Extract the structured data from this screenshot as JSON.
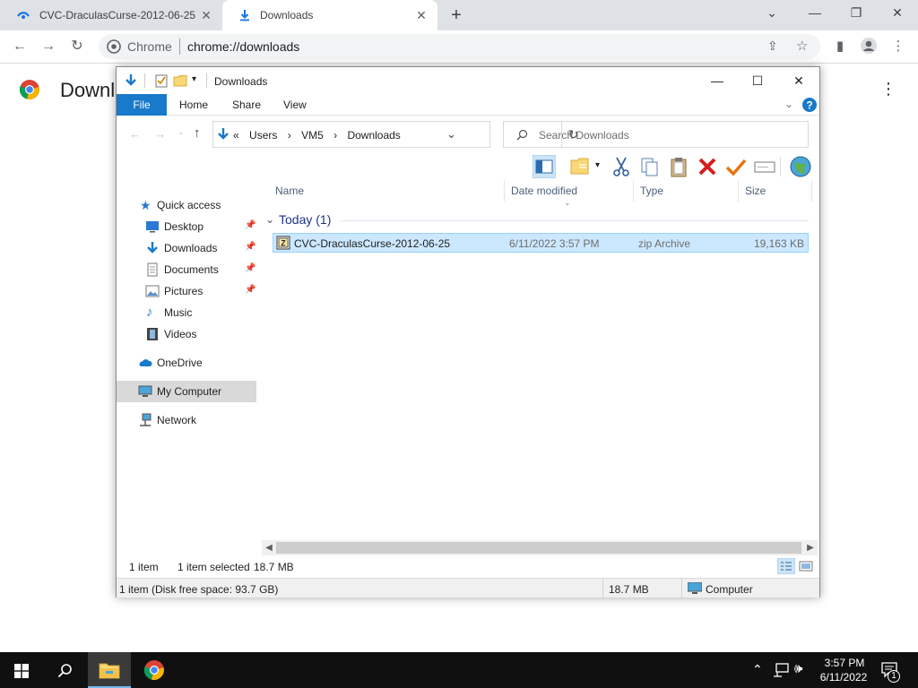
{
  "browser": {
    "tabs": [
      {
        "title": "CVC-DraculasCurse-2012-06-25",
        "icon": "tab-page-icon"
      },
      {
        "title": "Downloads",
        "icon": "download-icon",
        "active": true
      }
    ],
    "window_controls": {
      "minimize": "—",
      "restore": "❐",
      "close": "✕",
      "tab_search": "⌄"
    },
    "omnibox": {
      "site_label": "Chrome",
      "url": "chrome://downloads"
    },
    "page": {
      "heading": "Downloads"
    }
  },
  "explorer": {
    "title": "Downloads",
    "ribbon_tabs": [
      "File",
      "Home",
      "Share",
      "View"
    ],
    "address": {
      "prefix": "«",
      "crumbs": [
        "Users",
        "VM5",
        "Downloads"
      ]
    },
    "search_placeholder": "Search Downloads",
    "nav": {
      "quick_access": "Quick access",
      "desktop": "Desktop",
      "downloads": "Downloads",
      "documents": "Documents",
      "pictures": "Pictures",
      "music": "Music",
      "videos": "Videos",
      "onedrive": "OneDrive",
      "my_computer": "My Computer",
      "network": "Network"
    },
    "columns": {
      "name": "Name",
      "date": "Date modified",
      "type": "Type",
      "size": "Size"
    },
    "group": "Today (1)",
    "files": [
      {
        "name": "CVC-DraculasCurse-2012-06-25",
        "date": "6/11/2022 3:57 PM",
        "type": "zip Archive",
        "size": "19,163 KB"
      }
    ],
    "status": {
      "items": "1 item",
      "selected": "1 item selected",
      "selected_size": "18.7 MB",
      "disk": "1 item (Disk free space: 93.7 GB)",
      "size2": "18.7 MB",
      "location": "Computer"
    }
  },
  "taskbar": {
    "time": "3:57 PM",
    "date": "6/11/2022",
    "notifications": "1"
  },
  "colors": {
    "accent": "#1979ca",
    "selection": "#cce8ff",
    "taskbar": "#101010"
  }
}
